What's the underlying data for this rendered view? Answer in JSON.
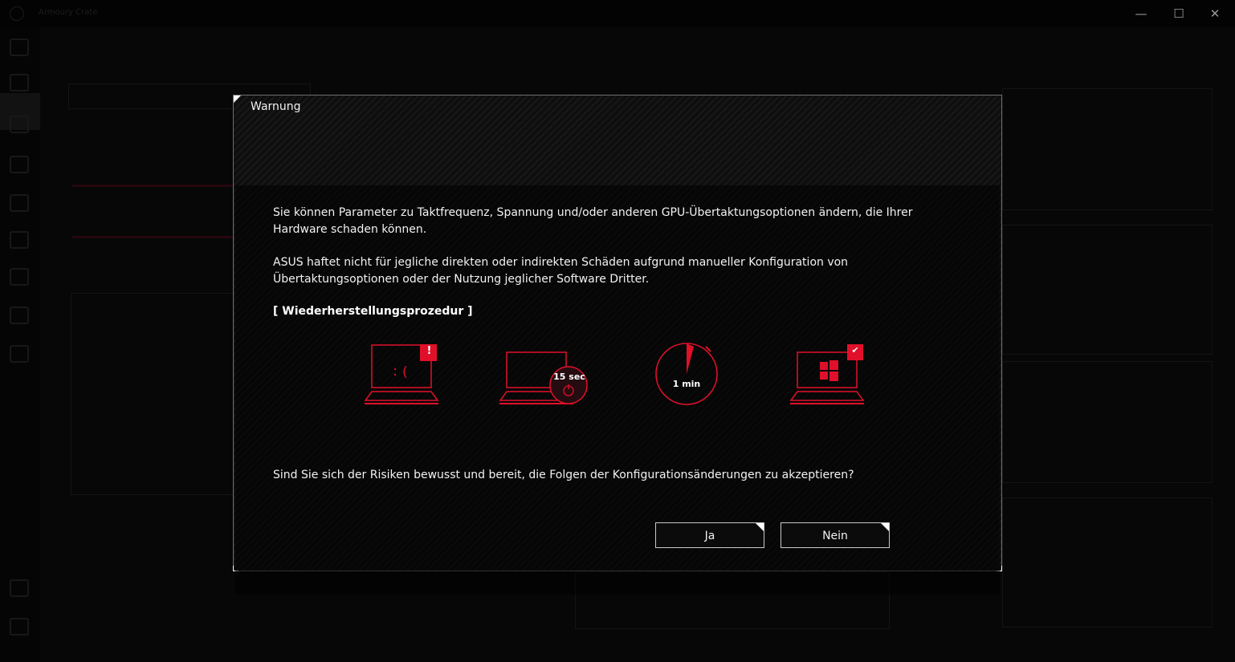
{
  "app": {
    "title": "Armoury Crate"
  },
  "window_controls": {
    "minimize": "—",
    "maximize": "☐",
    "close": "✕"
  },
  "dialog": {
    "title": "Warnung",
    "paragraph1": "Sie können Parameter zu Taktfrequenz, Spannung und/oder anderen GPU-Übertaktungsoptionen ändern, die Ihrer Hardware schaden können.",
    "paragraph2": "ASUS haftet nicht für jegliche direkten oder indirekten Schäden aufgrund manueller Konfiguration von Übertaktungsoptionen oder der Nutzung jeglicher Software Dritter.",
    "procedure_heading": "[ Wiederherstellungsprozedur ]",
    "steps": [
      {
        "icon": "laptop-error-icon",
        "badge": "!"
      },
      {
        "icon": "laptop-power-button-icon",
        "label": "15 sec"
      },
      {
        "icon": "timer-icon",
        "label": "1 min"
      },
      {
        "icon": "laptop-windows-check-icon",
        "badge": "✔"
      }
    ],
    "question": "Sind Sie sich der Risiken bewusst und bereit, die Folgen der Konfigurationsänderungen zu akzeptieren?",
    "buttons": {
      "yes": "Ja",
      "no": "Nein"
    }
  },
  "colors": {
    "accent_red": "#e0102a",
    "dialog_border": "#6e6e6e",
    "text": "#f2f2f2"
  }
}
